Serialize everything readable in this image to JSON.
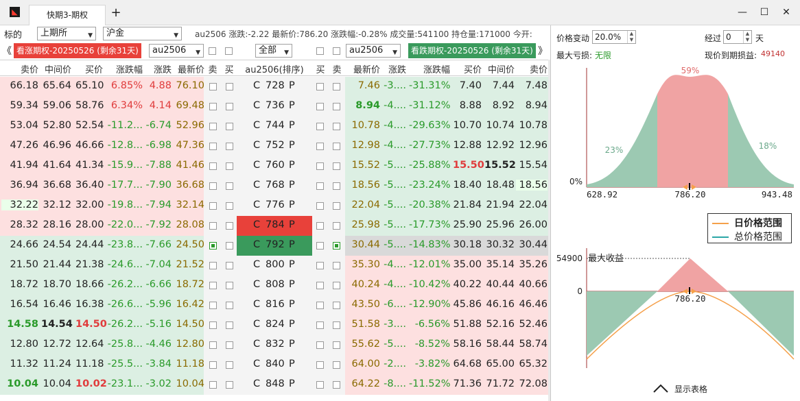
{
  "window": {
    "tab_title": "快期3-期权",
    "add_tab": "+",
    "minimize": "—",
    "maximize": "☐",
    "close": "✕"
  },
  "toolbar": {
    "label_target": "标的",
    "exchange": "上期所",
    "commodity": "沪金",
    "info_text": "au2506 涨跌:-2.22 最新价:786.20 涨跌幅:-0.28% 成交量:541100 持仓量:171000 今开:"
  },
  "bar2": {
    "left_arrow": "《",
    "call_label": "看涨期权-20250526 (剩余31天)",
    "call_contract": "au2506",
    "filter": "全部",
    "put_contract": "au2506",
    "put_label": "看跌期权-20250526 (剩余31天)",
    "right_arrow": "》",
    "colors": {
      "call_bg": "#e8413a",
      "put_bg": "#3a9a5c"
    }
  },
  "table": {
    "headers": [
      "卖价",
      "中间价",
      "买价",
      "涨跌幅",
      "涨跌",
      "最新价",
      "卖",
      "买",
      "au2506(排序)",
      "买",
      "卖",
      "最新价",
      "涨跌",
      "涨跌幅",
      "买价",
      "中间价",
      "卖价"
    ],
    "rows": [
      {
        "c_sell": "66.18",
        "c_mid": "65.64",
        "c_buy": "65.10",
        "c_pct": "6.85%",
        "c_chg": "4.88",
        "c_last": "76.10",
        "strike": "728",
        "p_last": "7.46",
        "p_chg": "-3....",
        "p_pct": "-31.31%",
        "p_buy": "7.40",
        "p_mid": "7.44",
        "p_sell": "7.48"
      },
      {
        "c_sell": "59.34",
        "c_mid": "59.06",
        "c_buy": "58.76",
        "c_pct": "6.34%",
        "c_chg": "4.14",
        "c_last": "69.48",
        "strike": "736",
        "p_last": "8.94",
        "p_chg": "-4....",
        "p_pct": "-31.12%",
        "p_buy": "8.88",
        "p_mid": "8.92",
        "p_sell": "8.94"
      },
      {
        "c_sell": "53.04",
        "c_mid": "52.80",
        "c_buy": "52.54",
        "c_pct": "-11.2...",
        "c_chg": "-6.74",
        "c_last": "52.96",
        "strike": "744",
        "p_last": "10.78",
        "p_chg": "-4....",
        "p_pct": "-29.63%",
        "p_buy": "10.70",
        "p_mid": "10.74",
        "p_sell": "10.78"
      },
      {
        "c_sell": "47.26",
        "c_mid": "46.96",
        "c_buy": "46.66",
        "c_pct": "-12.8...",
        "c_chg": "-6.98",
        "c_last": "47.36",
        "strike": "752",
        "p_last": "12.98",
        "p_chg": "-4....",
        "p_pct": "-27.73%",
        "p_buy": "12.88",
        "p_mid": "12.92",
        "p_sell": "12.96"
      },
      {
        "c_sell": "41.94",
        "c_mid": "41.64",
        "c_buy": "41.34",
        "c_pct": "-15.9...",
        "c_chg": "-7.88",
        "c_last": "41.46",
        "strike": "760",
        "p_last": "15.52",
        "p_chg": "-5....",
        "p_pct": "-25.88%",
        "p_buy": "15.50",
        "p_mid": "15.52",
        "p_sell": "15.54"
      },
      {
        "c_sell": "36.94",
        "c_mid": "36.68",
        "c_buy": "36.40",
        "c_pct": "-17.7...",
        "c_chg": "-7.90",
        "c_last": "36.68",
        "strike": "768",
        "p_last": "18.56",
        "p_chg": "-5....",
        "p_pct": "-23.24%",
        "p_buy": "18.40",
        "p_mid": "18.48",
        "p_sell": "18.56"
      },
      {
        "c_sell": "32.22",
        "c_mid": "32.12",
        "c_buy": "32.00",
        "c_pct": "-19.8...",
        "c_chg": "-7.94",
        "c_last": "32.14",
        "strike": "776",
        "p_last": "22.04",
        "p_chg": "-5....",
        "p_pct": "-20.38%",
        "p_buy": "21.84",
        "p_mid": "21.94",
        "p_sell": "22.04"
      },
      {
        "c_sell": "28.32",
        "c_mid": "28.16",
        "c_buy": "28.00",
        "c_pct": "-22.0...",
        "c_chg": "-7.92",
        "c_last": "28.08",
        "strike": "784",
        "p_last": "25.98",
        "p_chg": "-5....",
        "p_pct": "-17.73%",
        "p_buy": "25.90",
        "p_mid": "25.96",
        "p_sell": "26.00"
      },
      {
        "c_sell": "24.66",
        "c_mid": "24.54",
        "c_buy": "24.44",
        "c_pct": "-23.8...",
        "c_chg": "-7.66",
        "c_last": "24.50",
        "strike": "792",
        "p_last": "30.44",
        "p_chg": "-5....",
        "p_pct": "-14.83%",
        "p_buy": "30.18",
        "p_mid": "30.32",
        "p_sell": "30.44"
      },
      {
        "c_sell": "21.50",
        "c_mid": "21.44",
        "c_buy": "21.38",
        "c_pct": "-24.6...",
        "c_chg": "-7.04",
        "c_last": "21.52",
        "strike": "800",
        "p_last": "35.30",
        "p_chg": "-4....",
        "p_pct": "-12.01%",
        "p_buy": "35.00",
        "p_mid": "35.14",
        "p_sell": "35.26"
      },
      {
        "c_sell": "18.72",
        "c_mid": "18.70",
        "c_buy": "18.66",
        "c_pct": "-26.2...",
        "c_chg": "-6.66",
        "c_last": "18.72",
        "strike": "808",
        "p_last": "40.24",
        "p_chg": "-4....",
        "p_pct": "-10.42%",
        "p_buy": "40.22",
        "p_mid": "40.44",
        "p_sell": "40.66"
      },
      {
        "c_sell": "16.54",
        "c_mid": "16.46",
        "c_buy": "16.38",
        "c_pct": "-26.6...",
        "c_chg": "-5.96",
        "c_last": "16.42",
        "strike": "816",
        "p_last": "43.50",
        "p_chg": "-6....",
        "p_pct": "-12.90%",
        "p_buy": "45.86",
        "p_mid": "46.16",
        "p_sell": "46.46"
      },
      {
        "c_sell": "14.58",
        "c_mid": "14.54",
        "c_buy": "14.50",
        "c_pct": "-26.2...",
        "c_chg": "-5.16",
        "c_last": "14.50",
        "strike": "824",
        "p_last": "51.58",
        "p_chg": "-3....",
        "p_pct": "-6.56%",
        "p_buy": "51.88",
        "p_mid": "52.16",
        "p_sell": "52.46"
      },
      {
        "c_sell": "12.80",
        "c_mid": "12.72",
        "c_buy": "12.64",
        "c_pct": "-25.8...",
        "c_chg": "-4.46",
        "c_last": "12.80",
        "strike": "832",
        "p_last": "55.62",
        "p_chg": "-5....",
        "p_pct": "-8.52%",
        "p_buy": "58.16",
        "p_mid": "58.44",
        "p_sell": "58.74"
      },
      {
        "c_sell": "11.32",
        "c_mid": "11.24",
        "c_buy": "11.18",
        "c_pct": "-25.5...",
        "c_chg": "-3.84",
        "c_last": "11.18",
        "strike": "840",
        "p_last": "64.00",
        "p_chg": "-2....",
        "p_pct": "-3.82%",
        "p_buy": "64.68",
        "p_mid": "65.00",
        "p_sell": "65.32"
      },
      {
        "c_sell": "10.04",
        "c_mid": "10.04",
        "c_buy": "10.02",
        "c_pct": "-23.1...",
        "c_chg": "-3.02",
        "c_last": "10.04",
        "strike": "848",
        "p_last": "64.22",
        "p_chg": "-8....",
        "p_pct": "-11.52%",
        "p_buy": "71.36",
        "p_mid": "71.72",
        "p_sell": "72.08"
      }
    ],
    "call_letter": "C",
    "put_letter": "P"
  },
  "panel": {
    "price_change_label": "价格变动",
    "price_change_value": "20.0%",
    "elapsed_label": "经过",
    "elapsed_value": "0",
    "elapsed_unit": "天",
    "max_loss_label": "最大亏损:",
    "max_loss_value": "无限",
    "expiry_pnl_label": "现价到期损益:",
    "expiry_pnl_value": "49140",
    "dist": {
      "pct_center": "59%",
      "pct_left": "23%",
      "pct_right": "18%",
      "zero": "0%",
      "x_left": "628.92",
      "x_center": "786.20",
      "x_right": "943.48"
    },
    "legend": {
      "daily": "日价格范围",
      "total": "总价格范围"
    },
    "payoff": {
      "y_max": "54900",
      "max_label": "最大收益",
      "y_zero": "0",
      "x_center": "786.20"
    },
    "footer": "显示表格",
    "colors": {
      "green": "#9cc9b2",
      "red": "#f0a3a3",
      "orange": "#f5a04a",
      "teal": "#2aa6a6"
    }
  }
}
